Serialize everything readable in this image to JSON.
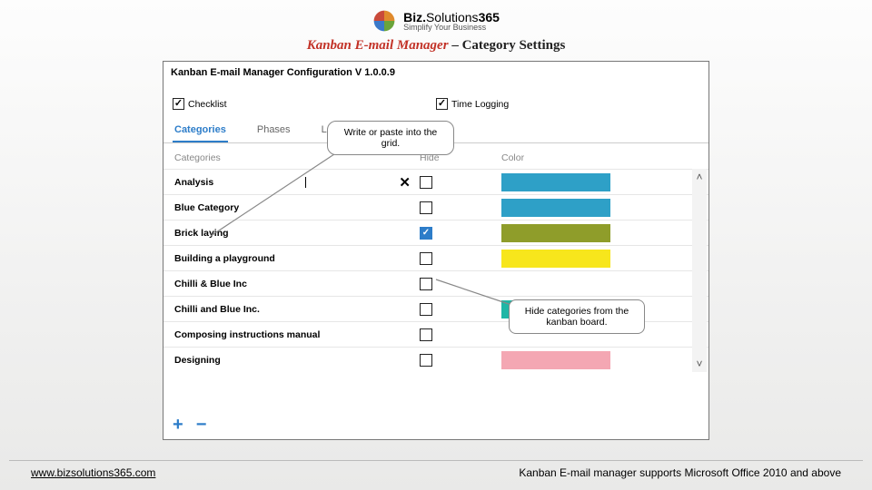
{
  "brand": {
    "name_a": "Biz.",
    "name_b": "Solutions",
    "name_c": "365",
    "tag": "Simplify Your Business"
  },
  "title": {
    "red": "Kanban E-mail Manager",
    "dash": " – ",
    "dark": "Category Settings"
  },
  "window_title": "Kanban E-mail Manager Configuration V 1.0.0.9",
  "features": {
    "checklist": "Checklist",
    "timelog": "Time Logging"
  },
  "tabs": {
    "categories": "Categories",
    "phases": "Phases",
    "lanes": "Lanes"
  },
  "columns": {
    "cat": "Categories",
    "hide": "Hide",
    "color": "Color"
  },
  "rows": [
    {
      "name": "Analysis",
      "hide": false,
      "color": "#2ea0c7",
      "editing": true
    },
    {
      "name": "Blue Category",
      "hide": false,
      "color": "#2ea0c7"
    },
    {
      "name": "Brick laying",
      "hide": true,
      "color": "#8f9d2a"
    },
    {
      "name": "Building a playground",
      "hide": false,
      "color": "#f7e61c"
    },
    {
      "name": "Chilli & Blue Inc",
      "hide": false,
      "color": ""
    },
    {
      "name": "Chilli and Blue Inc.",
      "hide": false,
      "color": "#1fb6a6"
    },
    {
      "name": "Composing instructions manual",
      "hide": false,
      "color": ""
    },
    {
      "name": "Designing",
      "hide": false,
      "color": "#f4a7b3"
    }
  ],
  "callouts": {
    "c1": "Write or paste into the grid.",
    "c2": "Hide categories from the kanban board."
  },
  "footer": {
    "url": "www.bizsolutions365.com",
    "note": "Kanban E-mail manager supports Microsoft Office 2010 and above"
  }
}
